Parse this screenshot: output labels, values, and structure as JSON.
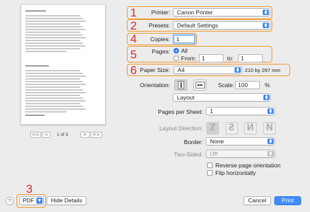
{
  "preview": {
    "page_indicator": "1 of 3",
    "first_page_glyph": "<<",
    "prev_page_glyph": "<",
    "next_page_glyph": ">",
    "last_page_glyph": ">>"
  },
  "form": {
    "printer": {
      "label": "Printer:",
      "value": "Canon Printer"
    },
    "presets": {
      "label": "Presets:",
      "value": "Default Settings"
    },
    "copies": {
      "label": "Copies:",
      "value": "1"
    },
    "pages": {
      "label": "Pages:",
      "all_label": "All",
      "from_label": "From:",
      "from_value": "1",
      "to_label": "to:",
      "to_value": "1"
    },
    "paper_size": {
      "label": "Paper Size:",
      "value": "A4",
      "dimensions": "210 by 297 mm"
    },
    "orientation": {
      "label": "Orientation:"
    },
    "scale": {
      "label": "Scale:",
      "value": "100",
      "unit": "%"
    },
    "section": {
      "value": "Layout"
    },
    "pages_per_sheet": {
      "label": "Pages per Sheet:",
      "value": "1"
    },
    "layout_direction": {
      "label": "Layout Direction:"
    },
    "border": {
      "label": "Border:",
      "value": "None"
    },
    "two_sided": {
      "label": "Two-Sided:",
      "value": "Off"
    },
    "reverse_orientation": {
      "label": "Reverse page orientation",
      "checked": false
    },
    "flip_horizontally": {
      "label": "Flip horizontally",
      "checked": false
    }
  },
  "annotations": [
    "1",
    "2",
    "3",
    "4",
    "5",
    "6"
  ],
  "footer": {
    "help": "?",
    "pdf": "PDF",
    "hide_details": "Hide Details",
    "cancel": "Cancel",
    "print": "Print"
  },
  "colors": {
    "accent": "#3a86f7",
    "annotation_box": "#f0972a",
    "annotation_number": "#d8282a"
  }
}
